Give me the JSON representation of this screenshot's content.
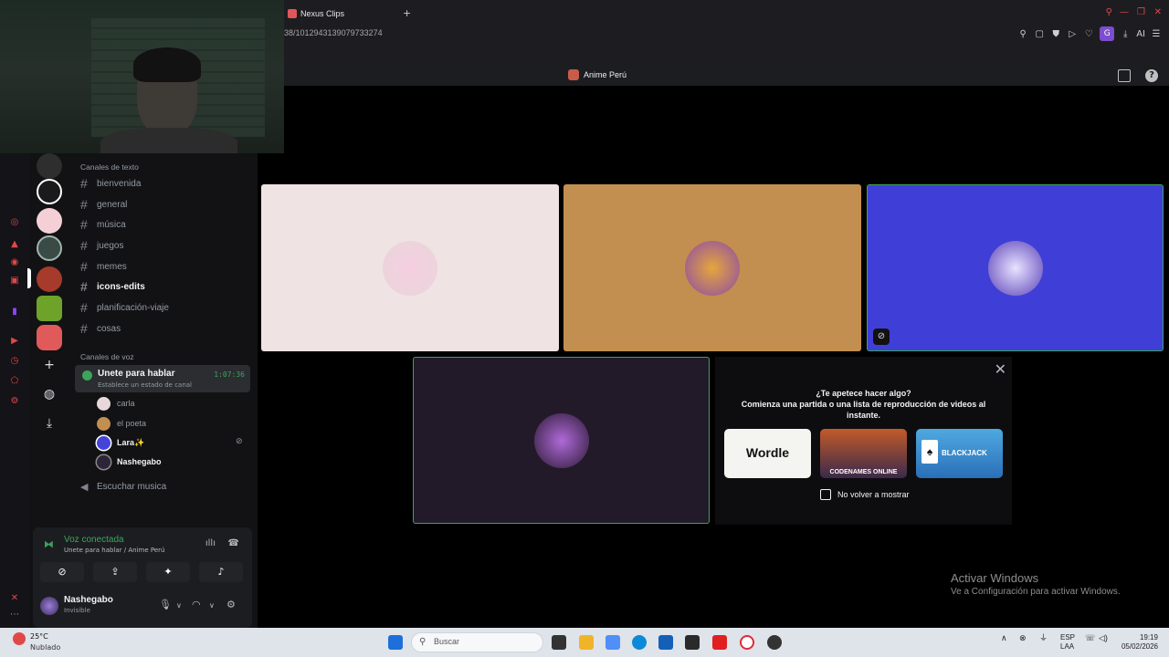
{
  "browser": {
    "tab_title": "Nexus Clips",
    "new_tab": "+",
    "url": "38/1012943139079733274",
    "profile_initial": "G",
    "ai_label": "AI"
  },
  "channel_header": {
    "server_name": "Anime Perú"
  },
  "sidebar": {
    "text_category": "Canales de texto",
    "text_channels": [
      {
        "name": "bienvenida"
      },
      {
        "name": "general"
      },
      {
        "name": "música"
      },
      {
        "name": "juegos"
      },
      {
        "name": "memes"
      },
      {
        "name": "icons-edits"
      },
      {
        "name": "planificación-viaje"
      },
      {
        "name": "cosas"
      }
    ],
    "voice_category": "Canales de voz",
    "voice_channel": {
      "name": "Unete para hablar",
      "status": "Establece un estado de canal",
      "timer": "1:07:36"
    },
    "voice_users": [
      {
        "name": "carla"
      },
      {
        "name": "el poeta"
      },
      {
        "name": "Lara✨"
      },
      {
        "name": "Nashegabo"
      }
    ],
    "music_channel": "Escuchar musica"
  },
  "user_panel": {
    "voice_status": "Voz conectada",
    "voice_location": "Unete para hablar / Anime Perú",
    "username": "Nashegabo",
    "status": "Invisible"
  },
  "activity": {
    "question": "¿Te apetece hacer algo?",
    "line1": "Comienza una partida o una lista de reproducción de videos al",
    "line2": "instante.",
    "games": [
      {
        "name": "Wordle"
      },
      {
        "name": "CODENAMES ONLINE"
      },
      {
        "name": "BLACKJACK"
      }
    ],
    "dont_show": "No volver a mostrar"
  },
  "watermark": {
    "title": "Activar Windows",
    "subtitle": "Ve a Configuración para activar Windows."
  },
  "taskbar": {
    "weather_temp": "25°C",
    "weather_desc": "Nublado",
    "search_placeholder": "Buscar",
    "lang1": "ESP",
    "lang2": "LAA",
    "time": "19:19",
    "date": "05/02/2026"
  },
  "colors": {
    "tile1": "#efe3e3",
    "tile2": "#c38f50",
    "tile3": "#3f3fd8",
    "tile4": "#231a29",
    "speaking_border": "#3ba55c"
  }
}
